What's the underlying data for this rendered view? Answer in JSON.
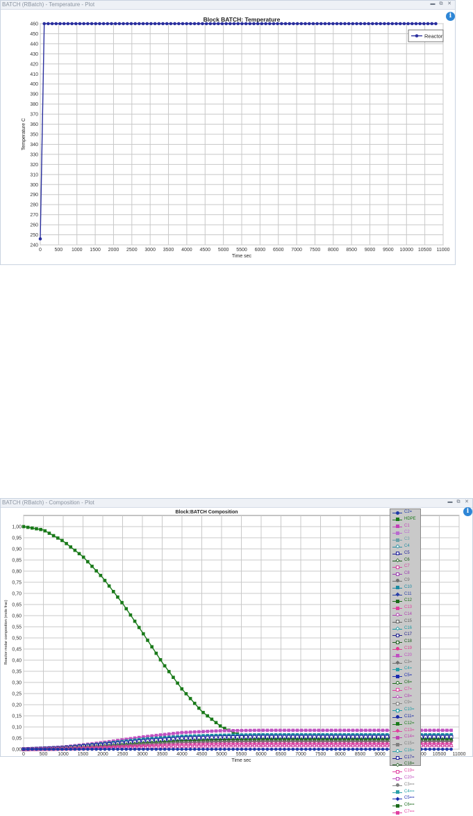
{
  "window1": {
    "title": "BATCH (RBatch) - Temperature - Plot",
    "info_icon": "info-icon",
    "controls": [
      "minimize-icon",
      "restore-icon",
      "close-icon"
    ]
  },
  "window2": {
    "title": "BATCH (RBatch) - Composition - Plot",
    "info_icon": "info-icon",
    "controls": [
      "minimize-icon",
      "restore-icon",
      "close-icon"
    ]
  },
  "chart_data": [
    {
      "type": "line",
      "title": "Block BATCH: Temperature",
      "xlabel": "Time sec",
      "ylabel": "Temperature C",
      "xlim": [
        0,
        11000
      ],
      "ylim": [
        240,
        460
      ],
      "xticks": [
        "0",
        "500",
        "1000",
        "1500",
        "2000",
        "2500",
        "3000",
        "3500",
        "4000",
        "4500",
        "5000",
        "5500",
        "6000",
        "6500",
        "7000",
        "7500",
        "8000",
        "8500",
        "9000",
        "9500",
        "10000",
        "10500",
        "11000"
      ],
      "yticks": [
        "240",
        "250",
        "260",
        "270",
        "280",
        "290",
        "300",
        "310",
        "320",
        "330",
        "340",
        "350",
        "360",
        "370",
        "380",
        "390",
        "400",
        "410",
        "420",
        "430",
        "440",
        "450",
        "460"
      ],
      "grid": true,
      "legend_position": "top-right",
      "series": [
        {
          "name": "Reactor",
          "color": "#2a2f9e",
          "marker": "circle",
          "points": [
            [
              0,
              246
            ],
            [
              108,
              460
            ],
            [
              10800,
              460
            ]
          ],
          "marker_step": 108
        }
      ]
    },
    {
      "type": "line",
      "title": "Block:BATCH Composition",
      "xlabel": "Time sec",
      "ylabel": "Reactor molar composition (mole frac)",
      "xlim": [
        0,
        11000
      ],
      "ylim": [
        0,
        1.05
      ],
      "xticks": [
        "0",
        "500",
        "1000",
        "1500",
        "2000",
        "2500",
        "3000",
        "3500",
        "4000",
        "4500",
        "5000",
        "5500",
        "6000",
        "6500",
        "7000",
        "7500",
        "8000",
        "8500",
        "9000",
        "9500",
        "10000",
        "10500",
        "11000"
      ],
      "yticks": [
        "0,00",
        "0,05",
        "0,10",
        "0,15",
        "0,20",
        "0,25",
        "0,30",
        "0,35",
        "0,40",
        "0,45",
        "0,50",
        "0,55",
        "0,60",
        "0,65",
        "0,70",
        "0,75",
        "0,80",
        "0,85",
        "0,90",
        "0,95",
        "1,00"
      ],
      "grid": true,
      "legend_position": "right",
      "legend": [
        {
          "name": "C2=",
          "color": "#1f3aa8",
          "marker": "circle"
        },
        {
          "name": "HDPE",
          "color": "#1a7a1a",
          "marker": "square"
        },
        {
          "name": "C1",
          "color": "#c23fb8",
          "marker": "triangle"
        },
        {
          "name": "C2",
          "color": "#b96ad0",
          "marker": "x"
        },
        {
          "name": "C3",
          "color": "#6aa0a8",
          "marker": "plus"
        },
        {
          "name": "C4",
          "color": "#2a8fa2",
          "marker": "circle-open"
        },
        {
          "name": "C5",
          "color": "#1a1a9a",
          "marker": "square-open"
        },
        {
          "name": "C6",
          "color": "#1a5a1a",
          "marker": "diamond-open"
        },
        {
          "name": "C7",
          "color": "#d040a0",
          "marker": "triangle-open"
        },
        {
          "name": "C8",
          "color": "#9a3ab0",
          "marker": "triangle-open"
        },
        {
          "name": "C9",
          "color": "#707070",
          "marker": "circle"
        },
        {
          "name": "C10",
          "color": "#1a8aa2",
          "marker": "square"
        },
        {
          "name": "C11",
          "color": "#2a40a8",
          "marker": "diamond"
        },
        {
          "name": "C12",
          "color": "#1a6a1a",
          "marker": "triangle"
        },
        {
          "name": "C13",
          "color": "#e040a0",
          "marker": "x"
        },
        {
          "name": "C14",
          "color": "#b040b0",
          "marker": "circle-open"
        },
        {
          "name": "C15",
          "color": "#606060",
          "marker": "square-open"
        },
        {
          "name": "C16",
          "color": "#1a9aa2",
          "marker": "diamond-open"
        },
        {
          "name": "C17",
          "color": "#1a1a8a",
          "marker": "triangle-open"
        },
        {
          "name": "C18",
          "color": "#1a5a1a",
          "marker": "triangle-open"
        },
        {
          "name": "C19",
          "color": "#e03a90",
          "marker": "circle"
        },
        {
          "name": "C20",
          "color": "#c050c0",
          "marker": "square"
        },
        {
          "name": "C3=",
          "color": "#707070",
          "marker": "diamond"
        },
        {
          "name": "C4=",
          "color": "#2aa0a8",
          "marker": "triangle"
        },
        {
          "name": "C5=",
          "color": "#1a2ab0",
          "marker": "triangle"
        },
        {
          "name": "C6=",
          "color": "#1a6a1a",
          "marker": "circle-open"
        },
        {
          "name": "C7=",
          "color": "#e040a0",
          "marker": "square-open"
        },
        {
          "name": "C8=",
          "color": "#b040b0",
          "marker": "diamond-open"
        },
        {
          "name": "C9=",
          "color": "#808080",
          "marker": "triangle-open"
        },
        {
          "name": "C10=",
          "color": "#1a9aa2",
          "marker": "triangle-open"
        },
        {
          "name": "C11=",
          "color": "#1a2aa8",
          "marker": "circle"
        },
        {
          "name": "C12=",
          "color": "#1a7a1a",
          "marker": "square"
        },
        {
          "name": "C13=",
          "color": "#e040a0",
          "marker": "diamond"
        },
        {
          "name": "C14=",
          "color": "#c040b0",
          "marker": "triangle"
        },
        {
          "name": "C15=",
          "color": "#808080",
          "marker": "x"
        },
        {
          "name": "C16=",
          "color": "#2aa0a8",
          "marker": "circle-open"
        },
        {
          "name": "C17=",
          "color": "#1a1a9a",
          "marker": "square-open"
        },
        {
          "name": "C18=",
          "color": "#1a5a1a",
          "marker": "diamond-open"
        },
        {
          "name": "C19=",
          "color": "#e040a0",
          "marker": "triangle-open"
        },
        {
          "name": "C20=",
          "color": "#c050c0",
          "marker": "triangle-open"
        },
        {
          "name": "C3==",
          "color": "#808080",
          "marker": "circle"
        },
        {
          "name": "C4==",
          "color": "#2aa0a8",
          "marker": "square"
        },
        {
          "name": "C5==",
          "color": "#1a2ab0",
          "marker": "diamond"
        },
        {
          "name": "C6==",
          "color": "#1a6a1a",
          "marker": "triangle"
        },
        {
          "name": "C7==",
          "color": "#e040a0",
          "marker": "triangle"
        }
      ],
      "series": [
        {
          "name": "HDPE",
          "color": "#1a7a1a",
          "marker": "square",
          "points": [
            [
              0,
              1.0
            ],
            [
              500,
              0.985
            ],
            [
              1000,
              0.935
            ],
            [
              1500,
              0.865
            ],
            [
              2000,
              0.77
            ],
            [
              2500,
              0.655
            ],
            [
              3000,
              0.525
            ],
            [
              3500,
              0.39
            ],
            [
              4000,
              0.27
            ],
            [
              4500,
              0.17
            ],
            [
              5000,
              0.1
            ],
            [
              5500,
              0.06
            ],
            [
              6000,
              0.05
            ],
            [
              7000,
              0.05
            ],
            [
              8000,
              0.05
            ],
            [
              9000,
              0.05
            ],
            [
              10000,
              0.05
            ],
            [
              10800,
              0.05
            ]
          ]
        },
        {
          "name": "C20",
          "color": "#c050c0",
          "marker": "square",
          "points": [
            [
              0,
              0.0
            ],
            [
              1000,
              0.01
            ],
            [
              2000,
              0.03
            ],
            [
              3000,
              0.055
            ],
            [
              4000,
              0.075
            ],
            [
              5000,
              0.083
            ],
            [
              6000,
              0.085
            ],
            [
              8000,
              0.085
            ],
            [
              10800,
              0.085
            ]
          ]
        },
        {
          "name": "C10",
          "color": "#1a8aa2",
          "marker": "square",
          "points": [
            [
              0,
              0.0
            ],
            [
              1000,
              0.008
            ],
            [
              2000,
              0.025
            ],
            [
              3000,
              0.045
            ],
            [
              4000,
              0.058
            ],
            [
              5000,
              0.063
            ],
            [
              6000,
              0.065
            ],
            [
              8000,
              0.065
            ],
            [
              10800,
              0.065
            ]
          ]
        },
        {
          "name": "C5",
          "color": "#1a1a9a",
          "marker": "square-open",
          "points": [
            [
              0,
              0.0
            ],
            [
              1000,
              0.006
            ],
            [
              2000,
              0.02
            ],
            [
              3000,
              0.036
            ],
            [
              4000,
              0.048
            ],
            [
              5000,
              0.053
            ],
            [
              6000,
              0.055
            ],
            [
              8000,
              0.055
            ],
            [
              10800,
              0.055
            ]
          ]
        },
        {
          "name": "C12",
          "color": "#1a6a1a",
          "marker": "triangle",
          "points": [
            [
              0,
              0.0
            ],
            [
              1000,
              0.005
            ],
            [
              2000,
              0.015
            ],
            [
              3000,
              0.028
            ],
            [
              4000,
              0.038
            ],
            [
              5000,
              0.043
            ],
            [
              6000,
              0.045
            ],
            [
              8000,
              0.045
            ],
            [
              10800,
              0.045
            ]
          ]
        },
        {
          "name": "C9",
          "color": "#707070",
          "marker": "circle",
          "points": [
            [
              0,
              0.0
            ],
            [
              1000,
              0.004
            ],
            [
              2000,
              0.012
            ],
            [
              3000,
              0.022
            ],
            [
              4000,
              0.03
            ],
            [
              5000,
              0.034
            ],
            [
              6000,
              0.035
            ],
            [
              8000,
              0.035
            ],
            [
              10800,
              0.035
            ]
          ]
        },
        {
          "name": "C13",
          "color": "#e040a0",
          "marker": "x",
          "points": [
            [
              0,
              0.0
            ],
            [
              1000,
              0.003
            ],
            [
              2000,
              0.009
            ],
            [
              3000,
              0.016
            ],
            [
              4000,
              0.022
            ],
            [
              5000,
              0.025
            ],
            [
              6000,
              0.026
            ],
            [
              8000,
              0.026
            ],
            [
              10800,
              0.026
            ]
          ]
        },
        {
          "name": "C7",
          "color": "#d040a0",
          "marker": "triangle-open",
          "points": [
            [
              0,
              0.0
            ],
            [
              1000,
              0.002
            ],
            [
              2000,
              0.006
            ],
            [
              3000,
              0.011
            ],
            [
              4000,
              0.015
            ],
            [
              5000,
              0.017
            ],
            [
              6000,
              0.018
            ],
            [
              8000,
              0.018
            ],
            [
              10800,
              0.018
            ]
          ]
        },
        {
          "name": "C2=",
          "color": "#1f3aa8",
          "marker": "circle",
          "points": [
            [
              0,
              0.0
            ],
            [
              10800,
              0.0
            ]
          ]
        }
      ]
    }
  ]
}
